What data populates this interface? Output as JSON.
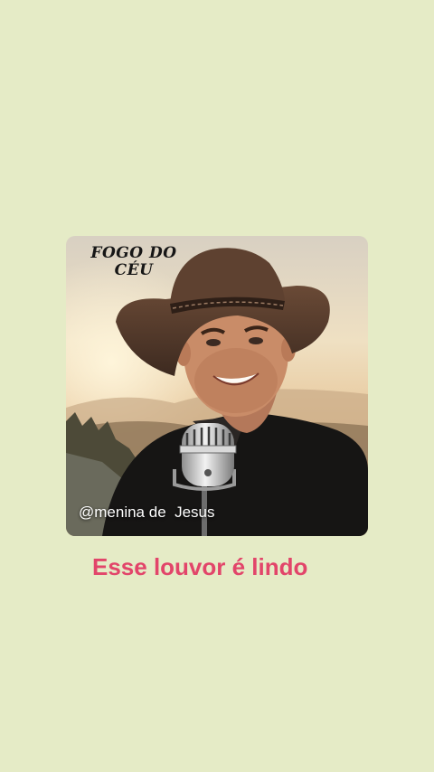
{
  "post": {
    "title": "FOGO DO CÉU",
    "handle": "@menina de  Jesus",
    "caption": "Esse louvor é lindo"
  },
  "colors": {
    "background": "#e5ebc6",
    "caption": "#e2456a",
    "title": "#161616",
    "handle": "#ffffff"
  },
  "image": {
    "subject": "smiling man in a brown cowboy hat singing into a vintage microphone at sunset"
  }
}
